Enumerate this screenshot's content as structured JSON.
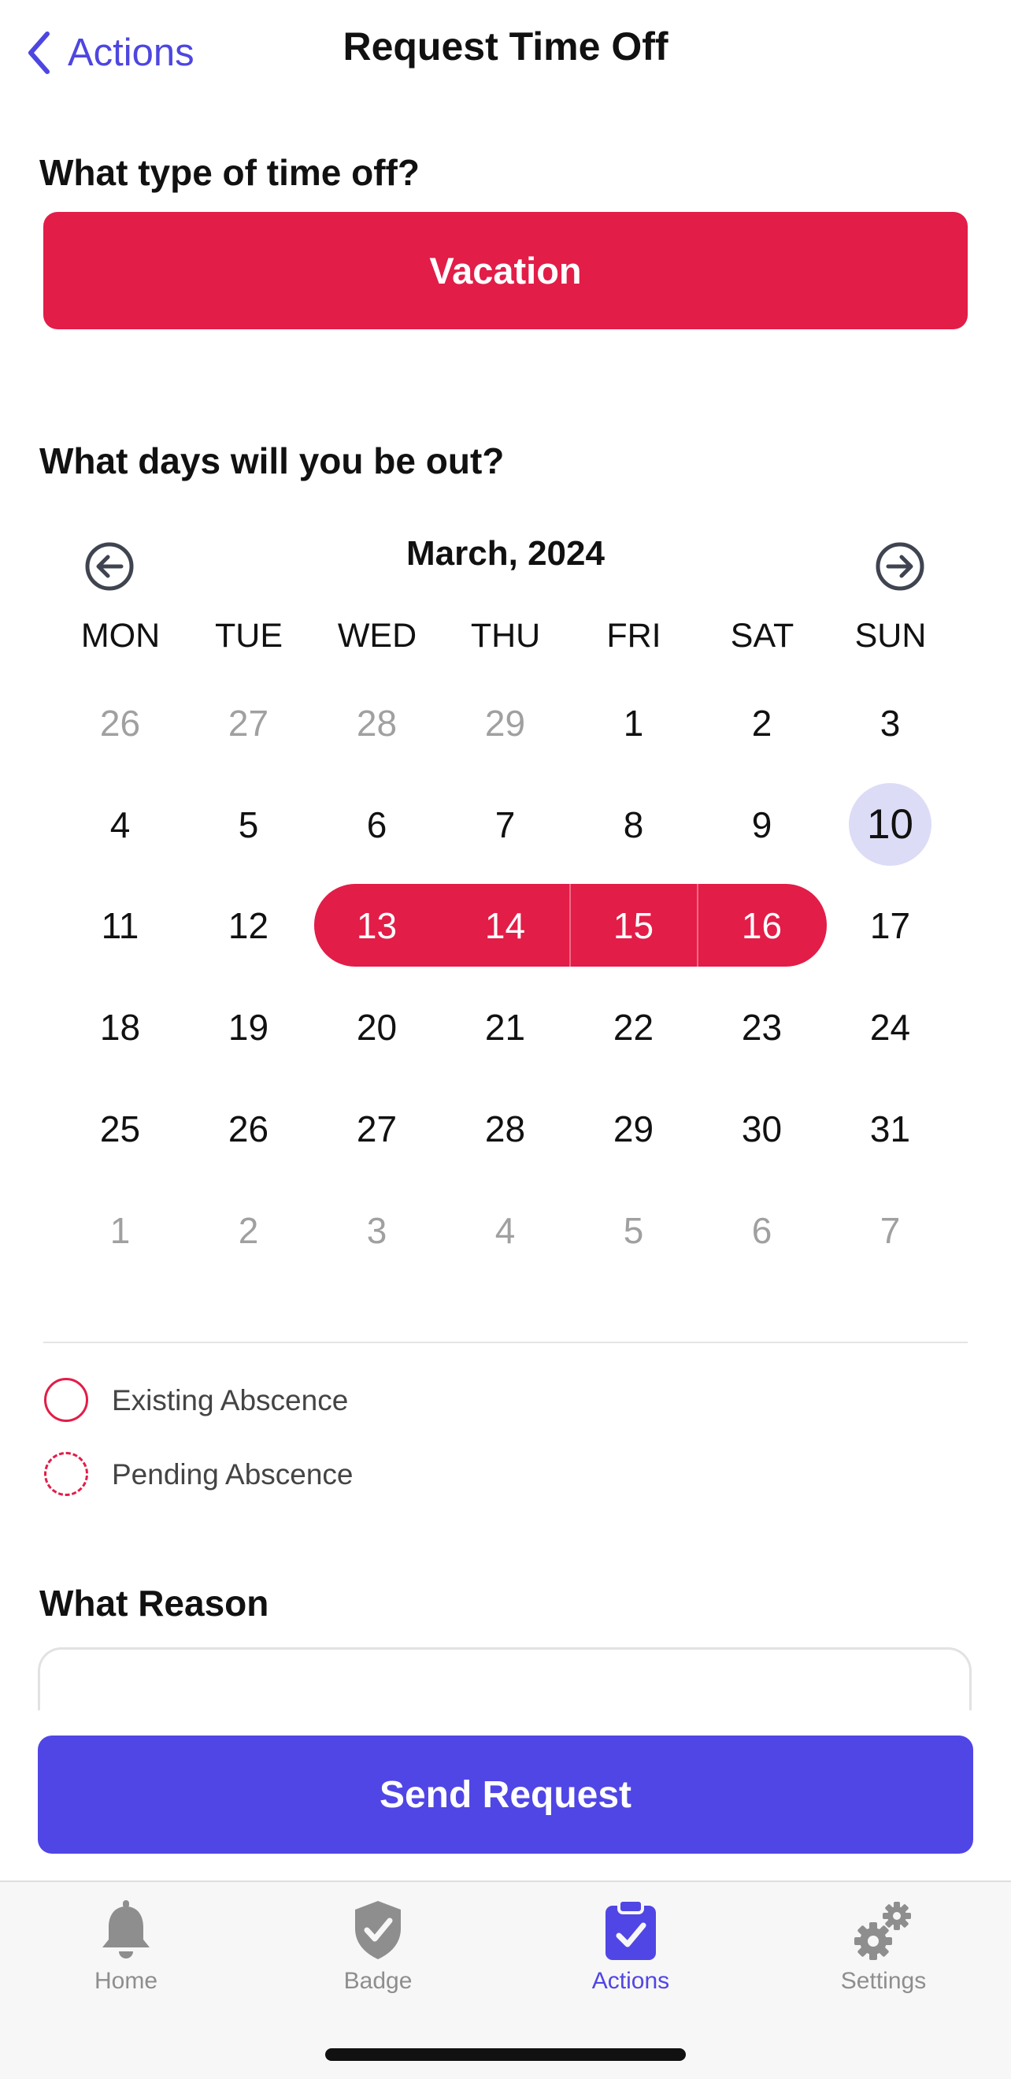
{
  "nav": {
    "back_label": "Actions",
    "title": "Request Time Off"
  },
  "type_section": {
    "label": "What type of time off?",
    "selected": "Vacation",
    "color": "#e21d48"
  },
  "days_section": {
    "label": "What days will you be out?"
  },
  "calendar": {
    "month": "March, 2024",
    "weekdays": [
      "MON",
      "TUE",
      "WED",
      "THU",
      "FRI",
      "SAT",
      "SUN"
    ],
    "weeks": [
      [
        "26",
        "27",
        "28",
        "29",
        "1",
        "2",
        "3"
      ],
      [
        "4",
        "5",
        "6",
        "7",
        "8",
        "9",
        "10"
      ],
      [
        "11",
        "12",
        "13",
        "14",
        "15",
        "16",
        "17"
      ],
      [
        "18",
        "19",
        "20",
        "21",
        "22",
        "23",
        "24"
      ],
      [
        "25",
        "26",
        "27",
        "28",
        "29",
        "30",
        "31"
      ],
      [
        "1",
        "2",
        "3",
        "4",
        "5",
        "6",
        "7"
      ]
    ],
    "muted": [
      [
        0,
        0
      ],
      [
        0,
        1
      ],
      [
        0,
        2
      ],
      [
        0,
        3
      ],
      [
        5,
        0
      ],
      [
        5,
        1
      ],
      [
        5,
        2
      ],
      [
        5,
        3
      ],
      [
        5,
        4
      ],
      [
        5,
        5
      ],
      [
        5,
        6
      ]
    ],
    "today": [
      1,
      6
    ],
    "selected_range": {
      "week": 2,
      "start": 2,
      "end": 5
    },
    "icons": {
      "prev": "arrow-left-circle-icon",
      "next": "arrow-right-circle-icon"
    }
  },
  "legend": {
    "existing": "Existing Abscence",
    "pending": "Pending Abscence"
  },
  "reason": {
    "label": "What Reason",
    "value": ""
  },
  "send_button": "Send Request",
  "tabs": [
    {
      "label": "Home",
      "icon": "bell-icon"
    },
    {
      "label": "Badge",
      "icon": "shield-check-icon"
    },
    {
      "label": "Actions",
      "icon": "clipboard-check-icon",
      "active": true
    },
    {
      "label": "Settings",
      "icon": "gears-icon"
    }
  ],
  "colors": {
    "accent": "#5046e5",
    "vacation": "#e21d48",
    "today_bg": "#dddcf6"
  }
}
